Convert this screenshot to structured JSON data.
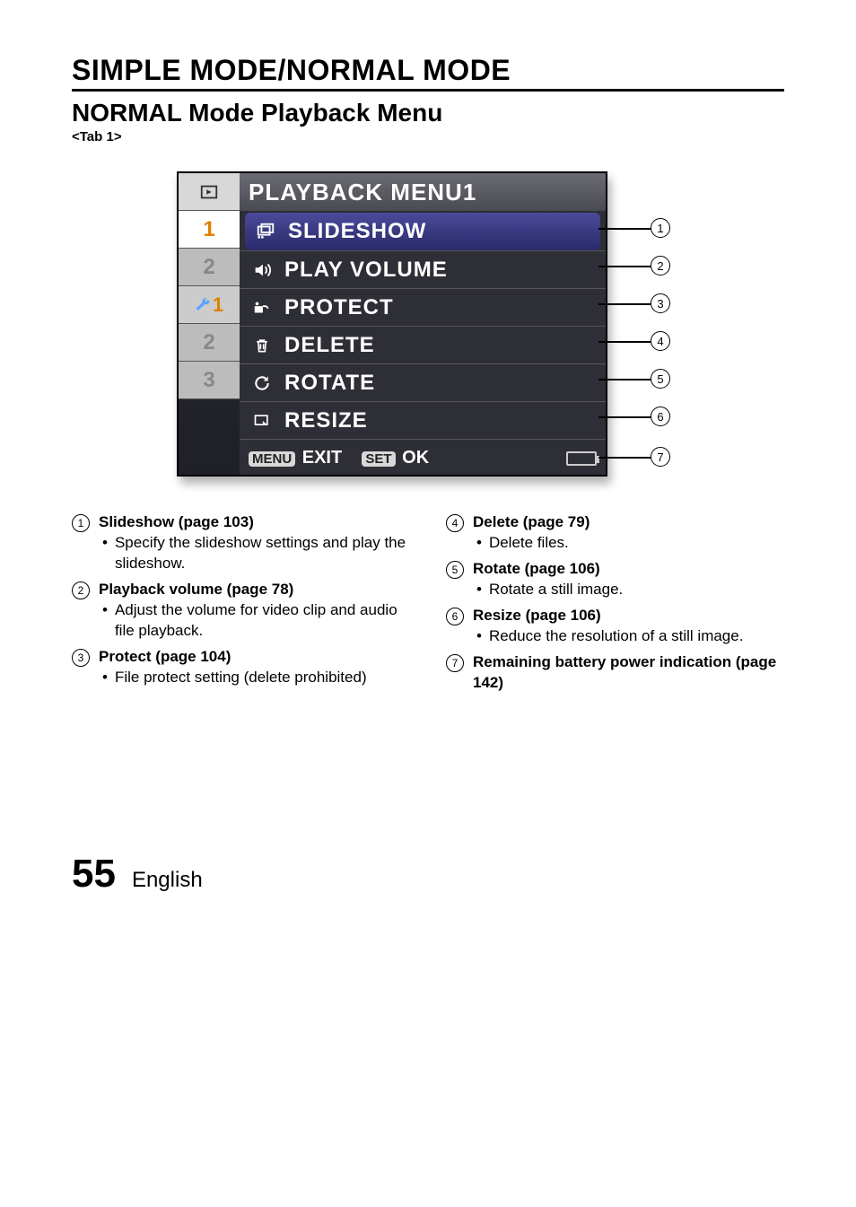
{
  "headings": {
    "section": "SIMPLE MODE/NORMAL MODE",
    "subsection": "NORMAL Mode Playback Menu",
    "tab": "<Tab 1>"
  },
  "lcd": {
    "title": "PLAYBACK MENU1",
    "left_tabs": {
      "play1": "1",
      "play2": "2",
      "setup1": "1",
      "setup2": "2",
      "setup3": "3"
    },
    "rows": [
      {
        "label": "SLIDESHOW"
      },
      {
        "label": "PLAY VOLUME"
      },
      {
        "label": "PROTECT"
      },
      {
        "label": "DELETE"
      },
      {
        "label": "ROTATE"
      },
      {
        "label": "RESIZE"
      }
    ],
    "bottom": {
      "menu_key": "MENU",
      "exit": "EXIT",
      "set_key": "SET",
      "ok": "OK"
    }
  },
  "callouts": [
    "1",
    "2",
    "3",
    "4",
    "5",
    "6",
    "7"
  ],
  "descriptions": {
    "left": [
      {
        "num": "1",
        "title": "Slideshow (page 103)",
        "body": "Specify the slideshow settings and play the slideshow."
      },
      {
        "num": "2",
        "title": "Playback volume (page 78)",
        "body": "Adjust the volume for video clip and audio file playback."
      },
      {
        "num": "3",
        "title": "Protect (page 104)",
        "body": "File protect setting (delete prohibited)"
      }
    ],
    "right": [
      {
        "num": "4",
        "title": "Delete (page 79)",
        "body": "Delete files."
      },
      {
        "num": "5",
        "title": "Rotate (page 106)",
        "body": "Rotate a still image."
      },
      {
        "num": "6",
        "title": "Resize (page 106)",
        "body": "Reduce the resolution of a still image."
      },
      {
        "num": "7",
        "title": "Remaining battery power indication (page 142)",
        "body": ""
      }
    ]
  },
  "footer": {
    "page": "55",
    "lang": "English"
  }
}
